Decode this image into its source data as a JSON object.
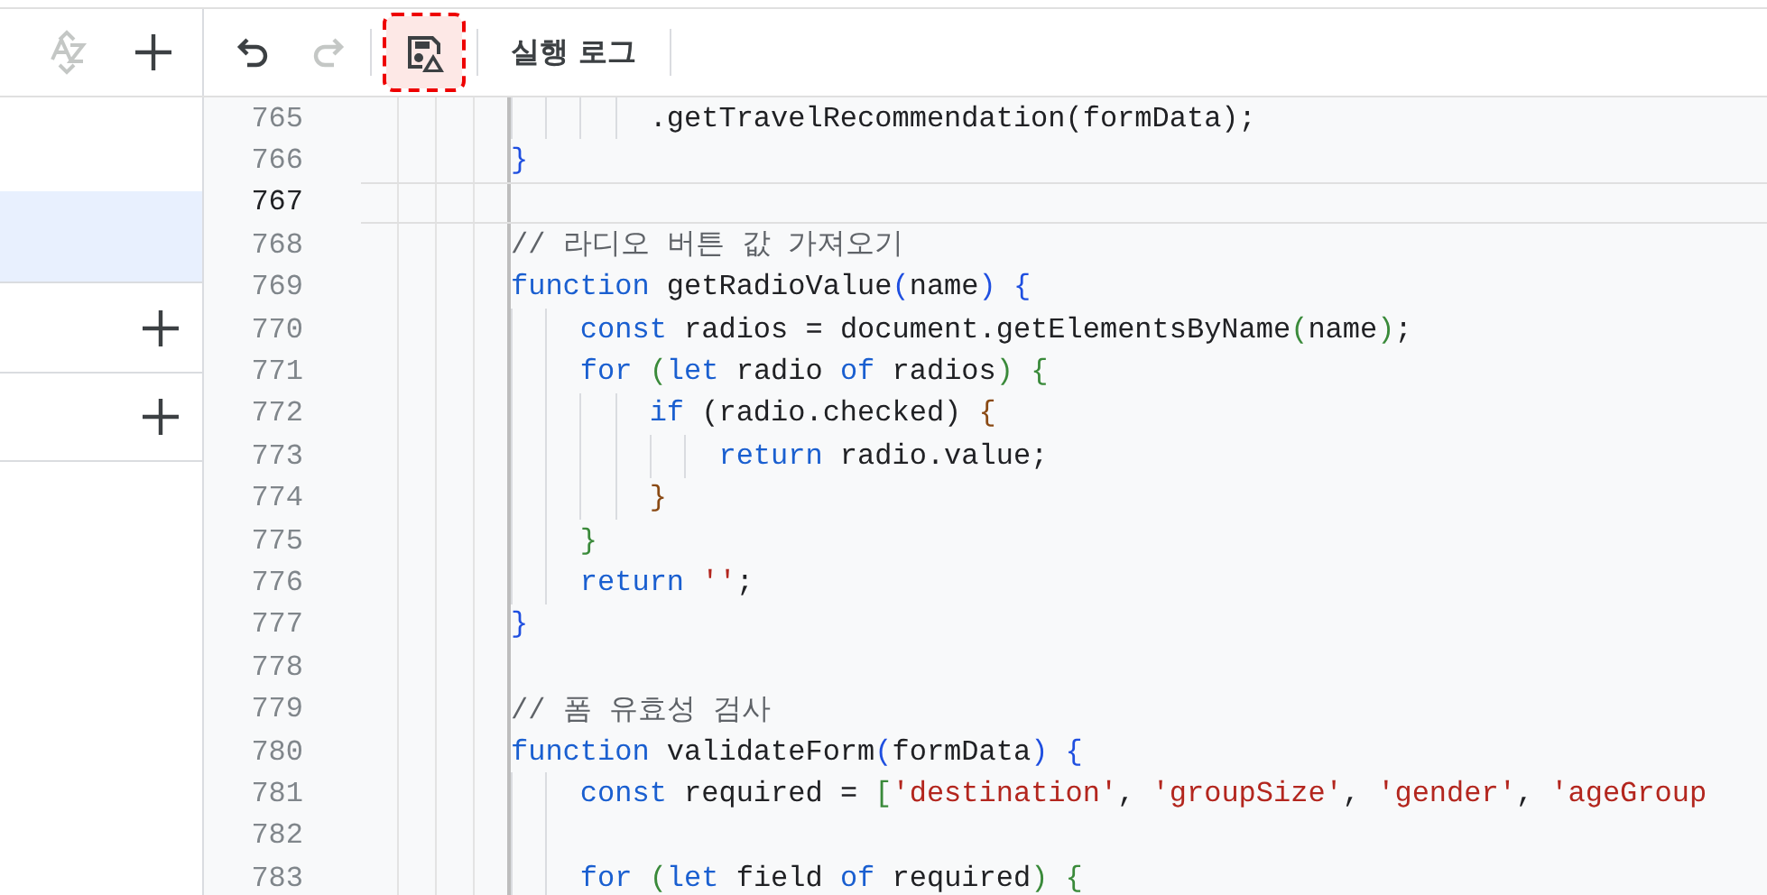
{
  "toolbar": {
    "side_buttons": [
      {
        "kind": "sort",
        "disabled": true
      },
      {
        "kind": "add",
        "disabled": false
      }
    ],
    "buttons": [
      {
        "kind": "undo",
        "disabled": false,
        "highlighted": false
      },
      {
        "kind": "redo",
        "disabled": true,
        "highlighted": false
      },
      {
        "kind": "save",
        "disabled": false,
        "highlighted": true
      }
    ],
    "log_button": {
      "label": "실행 로그"
    }
  },
  "sidebar": {
    "items": [
      {
        "kind": "plain",
        "selected": false
      },
      {
        "kind": "plain",
        "selected": true
      },
      {
        "kind": "section",
        "selected": false
      },
      {
        "kind": "section",
        "selected": false
      }
    ]
  },
  "editor": {
    "lines": [
      {
        "number": "765",
        "current": false,
        "tokens": [
          {
            "kind": "plain",
            "text": "        .getTravelRecommendation(formData);"
          }
        ]
      },
      {
        "number": "766",
        "current": false,
        "tokens": [
          {
            "kind": "bracket1",
            "text": "}"
          }
        ]
      },
      {
        "number": "767",
        "current": true
      },
      {
        "number": "768",
        "current": false,
        "tokens": [
          {
            "kind": "comment",
            "text": "// 라디오 버튼 값 가져오기"
          }
        ]
      },
      {
        "number": "769",
        "current": false,
        "tokens": [
          {
            "kind": "keyword",
            "text": "function"
          },
          {
            "kind": "plain",
            "text": " getRadioValue"
          },
          {
            "kind": "bracket1",
            "text": "("
          },
          {
            "kind": "plain",
            "text": "name"
          },
          {
            "kind": "bracket1",
            "text": ")"
          },
          {
            "kind": "bracket1",
            "text": " {"
          }
        ]
      },
      {
        "number": "770",
        "current": false,
        "tokens": [
          {
            "kind": "keyword",
            "text": "    const"
          },
          {
            "kind": "plain",
            "text": " radios = document.getElementsByName"
          },
          {
            "kind": "bracket2",
            "text": "("
          },
          {
            "kind": "plain",
            "text": "name"
          },
          {
            "kind": "bracket2",
            "text": ")"
          },
          {
            "kind": "plain",
            "text": ";"
          }
        ]
      },
      {
        "number": "771",
        "current": false,
        "tokens": [
          {
            "kind": "keyword",
            "text": "    for"
          },
          {
            "kind": "bracket2",
            "text": " ("
          },
          {
            "kind": "keyword",
            "text": "let"
          },
          {
            "kind": "plain",
            "text": " radio "
          },
          {
            "kind": "keyword",
            "text": "of"
          },
          {
            "kind": "plain",
            "text": " radios"
          },
          {
            "kind": "bracket2",
            "text": ")"
          },
          {
            "kind": "bracket2",
            "text": " {"
          }
        ]
      },
      {
        "number": "772",
        "current": false,
        "tokens": [
          {
            "kind": "keyword",
            "text": "        if"
          },
          {
            "kind": "plain",
            "text": " (radio.checked)"
          },
          {
            "kind": "bracket3",
            "text": " {"
          }
        ]
      },
      {
        "number": "773",
        "current": false,
        "tokens": [
          {
            "kind": "keyword",
            "text": "            return"
          },
          {
            "kind": "plain",
            "text": " radio.value;"
          }
        ]
      },
      {
        "number": "774",
        "current": false,
        "tokens": [
          {
            "kind": "bracket3",
            "text": "        }"
          }
        ]
      },
      {
        "number": "775",
        "current": false,
        "tokens": [
          {
            "kind": "bracket2",
            "text": "    }"
          }
        ]
      },
      {
        "number": "776",
        "current": false,
        "tokens": [
          {
            "kind": "keyword",
            "text": "    return"
          },
          {
            "kind": "string",
            "text": " ''"
          },
          {
            "kind": "plain",
            "text": ";"
          }
        ]
      },
      {
        "number": "777",
        "current": false,
        "tokens": [
          {
            "kind": "bracket1",
            "text": "}"
          }
        ]
      },
      {
        "number": "778",
        "current": false
      },
      {
        "number": "779",
        "current": false,
        "tokens": [
          {
            "kind": "comment",
            "text": "// 폼 유효성 검사"
          }
        ]
      },
      {
        "number": "780",
        "current": false,
        "tokens": [
          {
            "kind": "keyword",
            "text": "function"
          },
          {
            "kind": "plain",
            "text": " validateForm"
          },
          {
            "kind": "bracket1",
            "text": "("
          },
          {
            "kind": "plain",
            "text": "formData"
          },
          {
            "kind": "bracket1",
            "text": ")"
          },
          {
            "kind": "bracket1",
            "text": " {"
          }
        ]
      },
      {
        "number": "781",
        "current": false,
        "tokens": [
          {
            "kind": "keyword",
            "text": "    const"
          },
          {
            "kind": "plain",
            "text": " required ="
          },
          {
            "kind": "bracket2",
            "text": " ["
          },
          {
            "kind": "string",
            "text": "'destination'"
          },
          {
            "kind": "plain",
            "text": ","
          },
          {
            "kind": "string",
            "text": " 'groupSize'"
          },
          {
            "kind": "plain",
            "text": ","
          },
          {
            "kind": "string",
            "text": " 'gender'"
          },
          {
            "kind": "plain",
            "text": ","
          },
          {
            "kind": "string",
            "text": " 'ageGroup"
          }
        ]
      },
      {
        "number": "782",
        "current": false
      },
      {
        "number": "783",
        "current": false,
        "tokens": [
          {
            "kind": "keyword",
            "text": "    for"
          },
          {
            "kind": "bracket2",
            "text": " ("
          },
          {
            "kind": "keyword",
            "text": "let"
          },
          {
            "kind": "plain",
            "text": " field "
          },
          {
            "kind": "keyword",
            "text": "of"
          },
          {
            "kind": "plain",
            "text": " required"
          },
          {
            "kind": "bracket2",
            "text": ")"
          },
          {
            "kind": "bracket2",
            "text": " {"
          }
        ]
      }
    ]
  }
}
